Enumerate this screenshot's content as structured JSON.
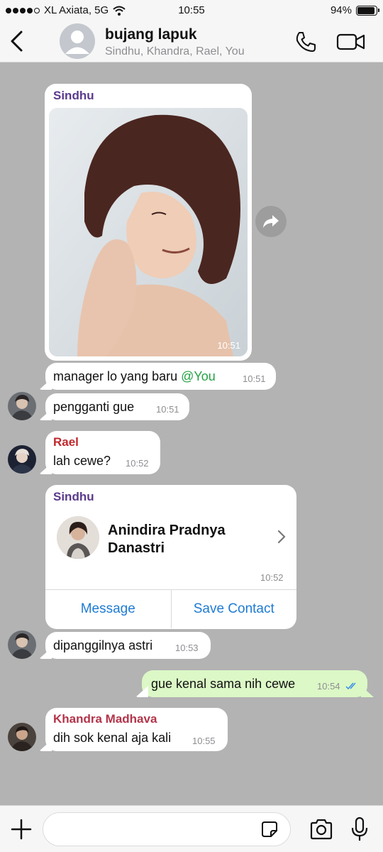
{
  "status_bar": {
    "carrier": "XL Axiata, 5G",
    "time": "10:55",
    "battery": "94%",
    "battery_level": 0.94
  },
  "header": {
    "title": "bujang lapuk",
    "subtitle": "Sindhu, Khandra, Rael, You"
  },
  "messages": {
    "photo": {
      "sender": "Sindhu",
      "time": "10:51"
    },
    "m1": {
      "text": "manager lo yang baru ",
      "mention": "@You",
      "time": "10:51"
    },
    "m2": {
      "text": "pengganti gue",
      "time": "10:51"
    },
    "m3": {
      "sender": "Rael",
      "text": "lah cewe?",
      "time": "10:52"
    },
    "contact": {
      "sender": "Sindhu",
      "name": "Anindira Pradnya Danastri",
      "time": "10:52",
      "message_label": "Message",
      "save_label": "Save Contact"
    },
    "m4": {
      "text": "dipanggilnya astri",
      "time": "10:53"
    },
    "m5": {
      "text": "gue kenal sama nih cewe",
      "time": "10:54",
      "status": "read"
    },
    "m6": {
      "sender": "Khandra Madhava",
      "text": "dih sok kenal aja kali",
      "time": "10:55"
    }
  },
  "colors": {
    "sindhu": "#5b3a8c",
    "rael": "#c0282d",
    "khandra": "#b3344a",
    "mention": "#25a244",
    "link": "#1e7bd4",
    "outgoing_bubble": "#dcf8c6",
    "chat_background": "#b3b3b3"
  },
  "composer": {
    "placeholder": ""
  }
}
